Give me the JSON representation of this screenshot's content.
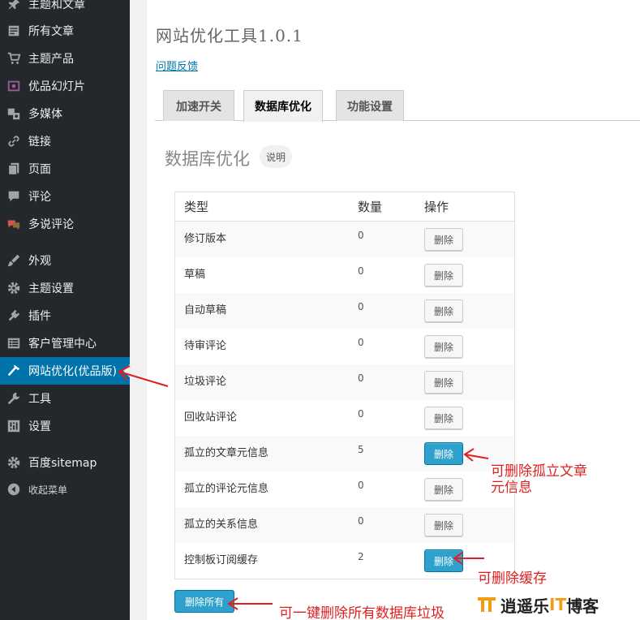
{
  "sidebar": {
    "items": [
      {
        "label": "主题和文章",
        "icon": "pin-icon"
      },
      {
        "label": "所有文章",
        "icon": "posts-icon"
      },
      {
        "label": "主题产品",
        "icon": "cart-icon"
      },
      {
        "label": "优品幻灯片",
        "icon": "slides-icon"
      },
      {
        "label": "多媒体",
        "icon": "media-icon"
      },
      {
        "label": "链接",
        "icon": "link-icon"
      },
      {
        "label": "页面",
        "icon": "page-icon"
      },
      {
        "label": "评论",
        "icon": "comment-icon"
      },
      {
        "label": "多说评论",
        "icon": "duoshuo-icon"
      },
      {
        "label": "外观",
        "icon": "brush-icon"
      },
      {
        "label": "主题设置",
        "icon": "gear-icon"
      },
      {
        "label": "插件",
        "icon": "plugin-icon"
      },
      {
        "label": "客户管理中心",
        "icon": "list-icon"
      },
      {
        "label": "网站优化(优品版)",
        "icon": "hammer-icon"
      },
      {
        "label": "工具",
        "icon": "wrench-icon"
      },
      {
        "label": "设置",
        "icon": "settings-icon"
      },
      {
        "label": "百度sitemap",
        "icon": "gear-icon"
      },
      {
        "label": "收起菜单",
        "icon": "collapse-icon"
      }
    ],
    "active_color": "#0073aa"
  },
  "page": {
    "title": "网站优化工具1.0.1",
    "feedback_link": "问题反馈"
  },
  "tabs": [
    {
      "label": "加速开关"
    },
    {
      "label": "数据库优化"
    },
    {
      "label": "功能设置"
    }
  ],
  "section": {
    "title": "数据库优化",
    "badge": "说明"
  },
  "table": {
    "headers": {
      "type": "类型",
      "count": "数量",
      "action": "操作"
    },
    "rows": [
      {
        "name": "修订版本",
        "count": "0",
        "action": "删除"
      },
      {
        "name": "草稿",
        "count": "0",
        "action": "删除"
      },
      {
        "name": "自动草稿",
        "count": "0",
        "action": "删除"
      },
      {
        "name": "待审评论",
        "count": "0",
        "action": "删除"
      },
      {
        "name": "垃圾评论",
        "count": "0",
        "action": "删除"
      },
      {
        "name": "回收站评论",
        "count": "0",
        "action": "删除"
      },
      {
        "name": "孤立的文章元信息",
        "count": "5",
        "action": "删除"
      },
      {
        "name": "孤立的评论元信息",
        "count": "0",
        "action": "删除"
      },
      {
        "name": "孤立的关系信息",
        "count": "0",
        "action": "删除"
      },
      {
        "name": "控制板订阅缓存",
        "count": "2",
        "action": "删除"
      }
    ],
    "delete_all": "删除所有"
  },
  "annotations": {
    "orphan_line1": "可删除孤立文章",
    "orphan_line2": "元信息",
    "cache": "可删除缓存",
    "delete_all": "可一键删除所有数据库垃圾",
    "color": "#e02020"
  },
  "watermark": {
    "part1": "逍遥乐",
    "part2": "IT",
    "part3": "博客"
  }
}
